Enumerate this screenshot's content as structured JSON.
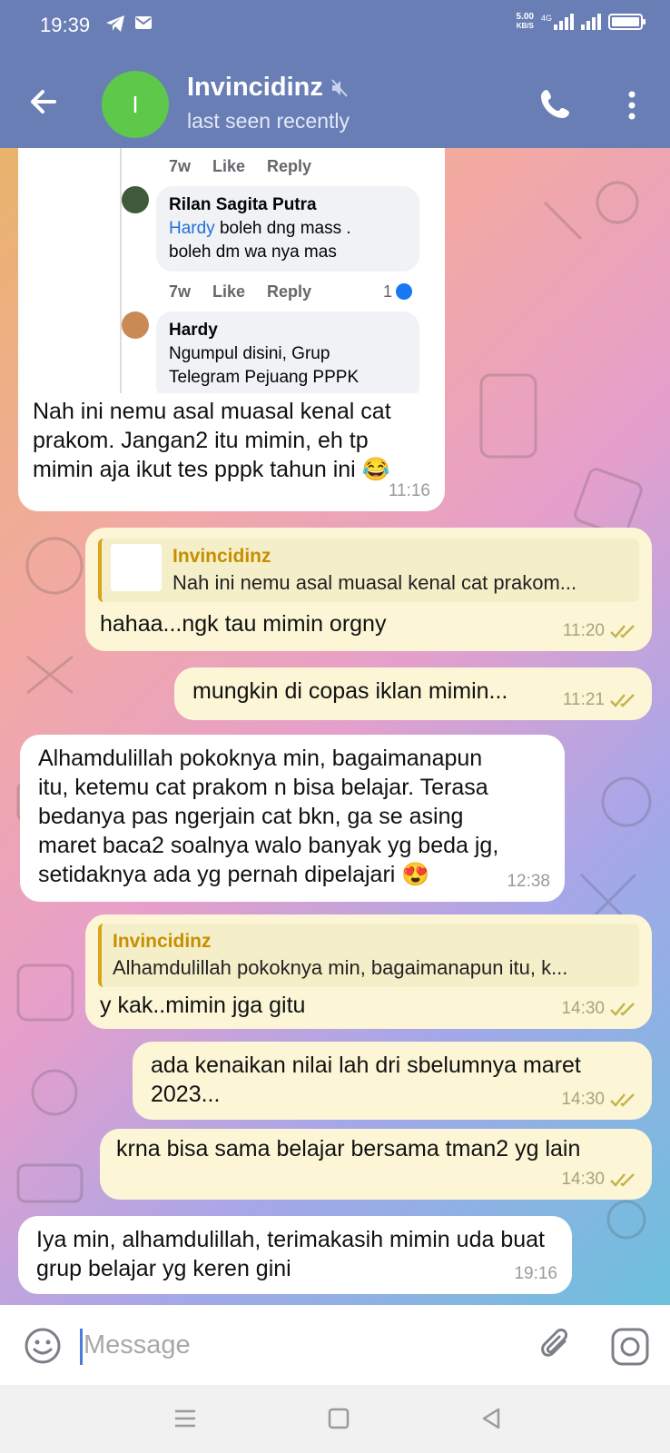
{
  "status_bar": {
    "time": "19:39",
    "net_speed_value": "5.00",
    "net_speed_unit": "KB/S",
    "network_type": "4G"
  },
  "chat": {
    "title": "Invincidinz",
    "subtitle": "last seen recently",
    "avatar_initial": "I",
    "avatar_color": "#5ec84a",
    "header_color": "#6a7eb6"
  },
  "screenshot_embed": {
    "meta_1": {
      "age": "7w",
      "like": "Like",
      "reply": "Reply"
    },
    "comment_1": {
      "name": "Rilan Sagita Putra",
      "mention": "Hardy",
      "text_after_mention": " boleh dng mass .",
      "line2": "boleh dm wa nya mas"
    },
    "meta_2": {
      "age": "7w",
      "like": "Like",
      "reply": "Reply",
      "like_count": "1"
    },
    "comment_2": {
      "name": "Hardy",
      "line1": "Ngumpul disini, Grup",
      "line2": "Telegram Pejuang PPPK"
    }
  },
  "messages": [
    {
      "direction": "in",
      "text": "Nah ini nemu asal muasal kenal cat prakom. Jangan2 itu mimin, eh tp mimin aja ikut tes pppk tahun ini 😂",
      "time": "11:16"
    },
    {
      "direction": "out",
      "reply_to": {
        "name": "Invincidinz",
        "text": "Nah ini nemu asal muasal kenal cat prakom..."
      },
      "text": "hahaa...ngk tau mimin orgny",
      "time": "11:20"
    },
    {
      "direction": "out",
      "text": "mungkin di copas iklan mimin...",
      "time": "11:21"
    },
    {
      "direction": "in",
      "text": "Alhamdulillah pokoknya min, bagaimanapun itu, ketemu cat prakom n bisa belajar. Terasa bedanya pas ngerjain cat bkn, ga se asing maret baca2 soalnya walo banyak yg beda jg, setidaknya ada yg pernah dipelajari 😍",
      "time": "12:38"
    },
    {
      "direction": "out",
      "reply_to": {
        "name": "Invincidinz",
        "text": "Alhamdulillah pokoknya min, bagaimanapun itu, k..."
      },
      "text": "y kak..mimin jga gitu",
      "time": "14:30"
    },
    {
      "direction": "out",
      "text": "ada kenaikan nilai lah dri sbelumnya maret 2023...",
      "time": "14:30"
    },
    {
      "direction": "out",
      "text": "krna bisa sama belajar bersama tman2 yg lain",
      "time": "14:30"
    },
    {
      "direction": "in",
      "text": "Iya min, alhamdulillah, terimakasih mimin uda buat grup belajar yg keren gini",
      "time": "19:16"
    }
  ],
  "input": {
    "placeholder": "Message"
  },
  "icons": {
    "back": "arrow-left-icon",
    "mute": "muted-speaker-icon",
    "call": "phone-icon",
    "menu": "more-vertical-icon",
    "emoji": "smiley-icon",
    "attach": "paperclip-icon",
    "camera": "camera-icon",
    "read": "double-check-icon"
  },
  "colors": {
    "incoming_bubble": "#ffffff",
    "outgoing_bubble": "#fdf6d6",
    "reply_accent": "#d9a31c",
    "read_check": "#c4b44e"
  }
}
